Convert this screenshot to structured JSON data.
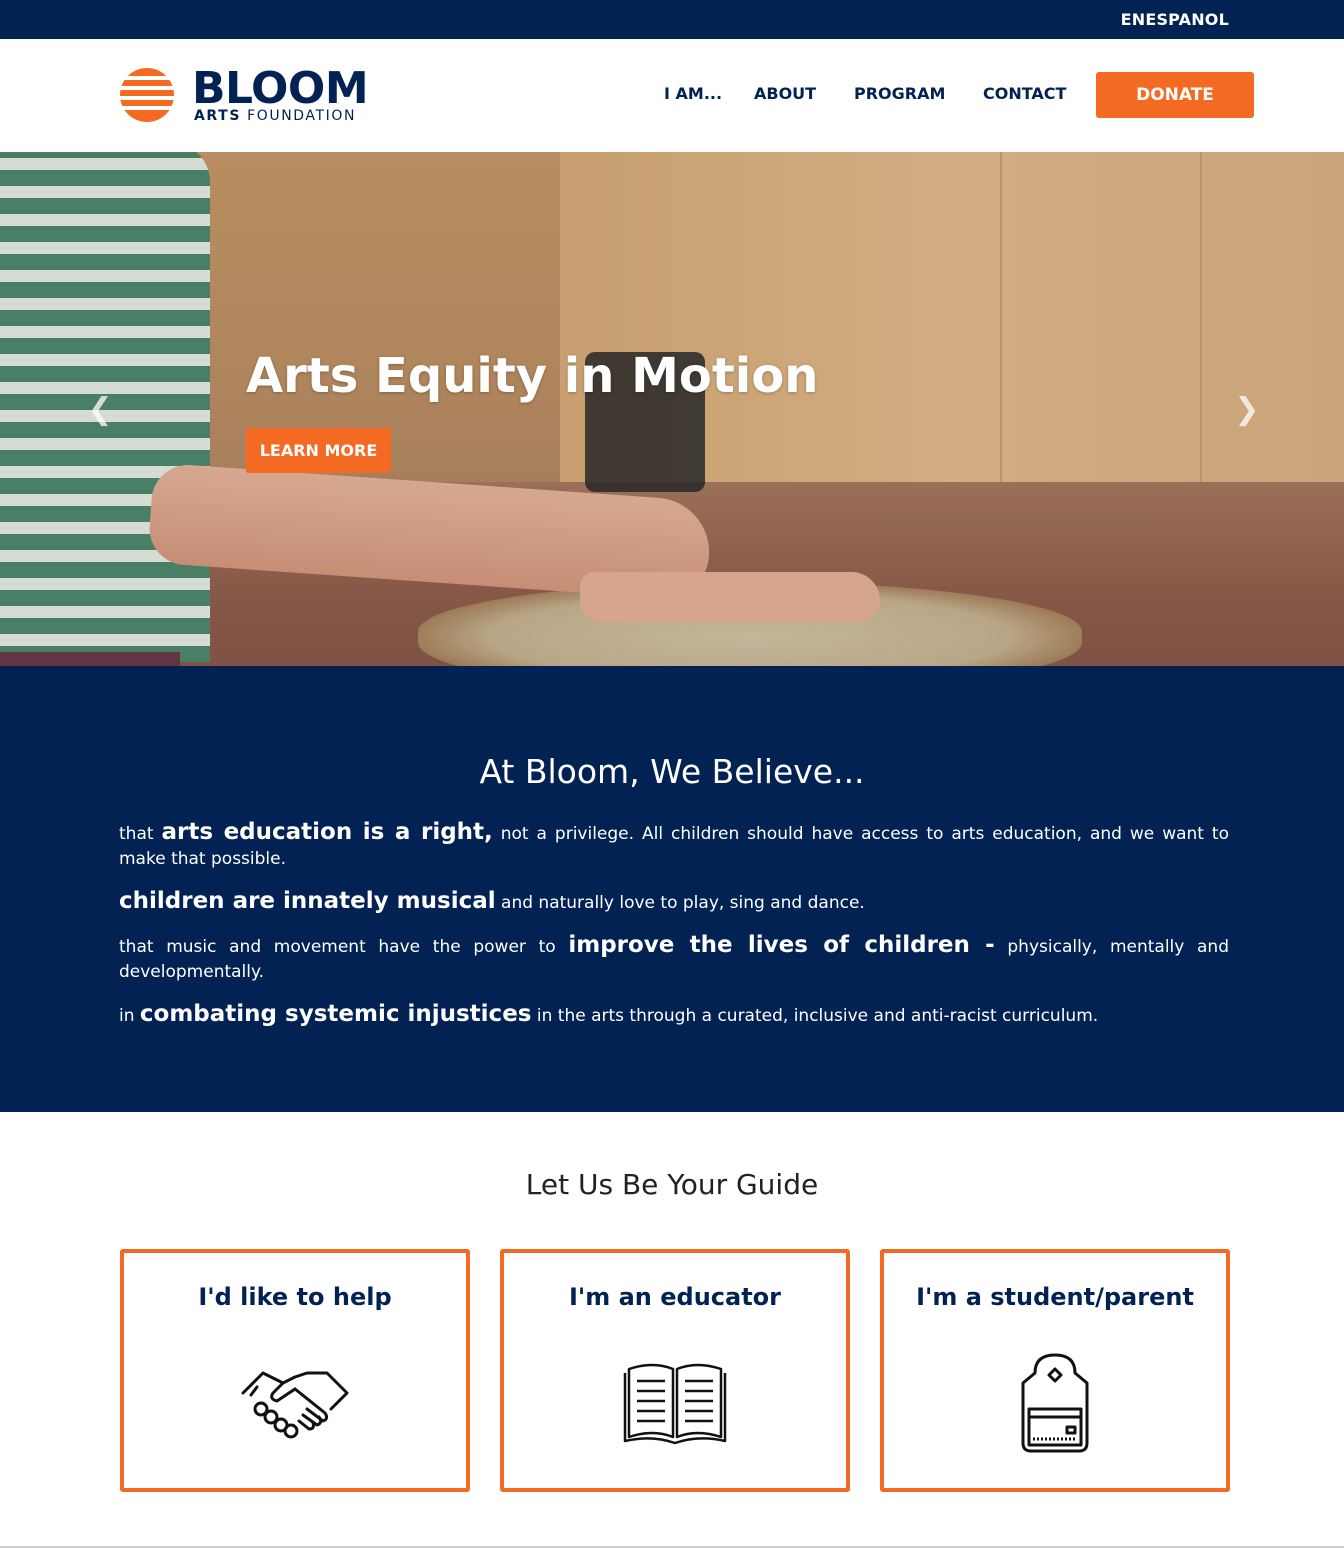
{
  "topbar": {
    "language_link": "ENESPANOL"
  },
  "header": {
    "logo": {
      "name": "BLOOM",
      "sub_bold": "ARTS",
      "sub_rest": "FOUNDATION"
    },
    "nav": [
      "I AM...",
      "ABOUT",
      "PROGRAM",
      "CONTACT"
    ],
    "donate": "DONATE"
  },
  "hero": {
    "title": "Arts Equity in Motion",
    "button": "LEARN MORE",
    "prev_icon": "chevron-left-icon",
    "next_icon": "chevron-right-icon"
  },
  "believe": {
    "heading": "At Bloom, We Believe...",
    "items": [
      {
        "before": "that ",
        "strong": "arts education is a right,",
        "after": " not a privilege. All children should have access to arts education, and we want to make that possible."
      },
      {
        "before": "",
        "strong": "children are innately musical",
        "after": " and naturally love to play, sing and dance."
      },
      {
        "before": "that music and movement have the power to ",
        "strong": "improve the lives of children -",
        "after": " physically, mentally and developmentally."
      },
      {
        "before": "in ",
        "strong": "combating systemic injustices",
        "after": " in the arts through a curated, inclusive and anti-racist curriculum."
      }
    ]
  },
  "guide": {
    "heading": "Let Us Be Your Guide",
    "cards": [
      {
        "title": "I'd like to help",
        "icon": "handshake-icon"
      },
      {
        "title": "I'm an educator",
        "icon": "open-book-icon"
      },
      {
        "title": "I'm a student/parent",
        "icon": "backpack-icon"
      }
    ]
  },
  "colors": {
    "navy": "#022254",
    "orange": "#f46a22"
  }
}
